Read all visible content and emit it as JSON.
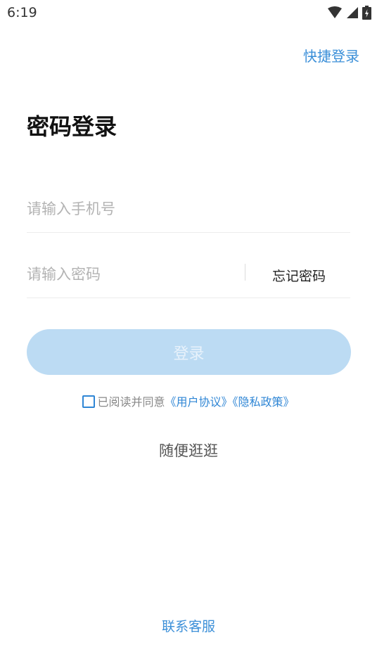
{
  "status_bar": {
    "time": "6:19",
    "icons": [
      "wifi-icon",
      "signal-icon",
      "battery-icon"
    ]
  },
  "header": {
    "quick_login_label": "快捷登录"
  },
  "main": {
    "title": "密码登录",
    "phone_placeholder": "请输入手机号",
    "password_placeholder": "请输入密码",
    "forgot_label": "忘记密码",
    "login_label": "登录"
  },
  "agreement": {
    "prefix": "已阅读并同意",
    "user_agreement": "《用户协议》",
    "privacy_policy": "《隐私政策》",
    "checked": false
  },
  "browse_label": "随便逛逛",
  "contact_label": "联系客服",
  "colors": {
    "accent": "#3b8fd8",
    "button_disabled": "#bcdbf3",
    "placeholder": "#b3b3b3"
  }
}
